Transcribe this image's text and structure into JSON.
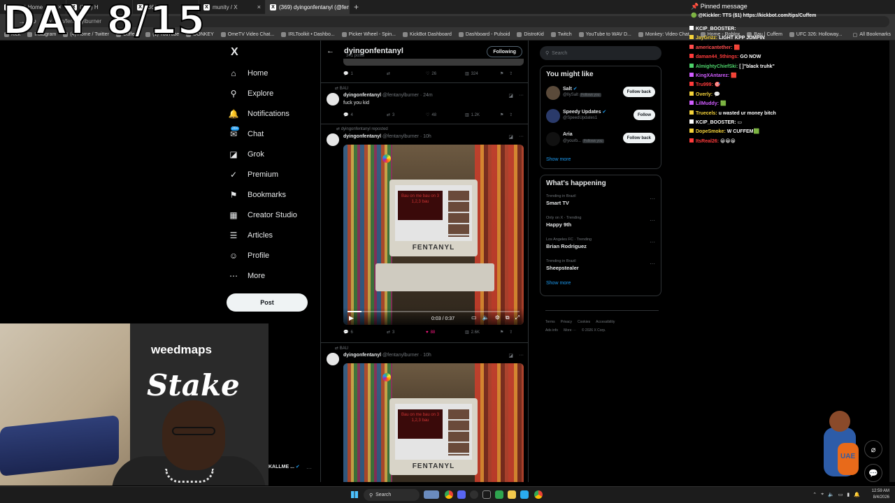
{
  "overlay": {
    "day_title": "DAY 8/15"
  },
  "browser": {
    "tabs": [
      {
        "label": "(369) Home",
        "active": false
      },
      {
        "label": "(369) H",
        "active": false
      },
      {
        "label": "(369)",
        "active": false
      },
      {
        "label": "munity / X",
        "active": false
      },
      {
        "label": "(369) dyingonfentanyl (@fenta",
        "active": true
      }
    ],
    "new_tab": "+",
    "url": "x.com/fentanylburner",
    "bookmarks": [
      "Kick",
      "Instagram",
      "(4) Home / Twitter",
      "Cuffem",
      "(1) YouTube",
      "DONKEY",
      "OmeTV Video Chat...",
      "IRLToolkit • Dashbo...",
      "Picker Wheel - Spin...",
      "KickBot Dashboard",
      "Dashboard - Pulsoid",
      "DistroKid",
      "Twitch",
      "YouTube to WAV D...",
      "Monkey: Video Chat...",
      "Home - Roblox",
      "Bau | Cuffem",
      "UFC 326: Holloway..."
    ],
    "all_bookmarks": "All Bookmarks"
  },
  "x_nav": {
    "logo": "X",
    "items": [
      {
        "label": "Home",
        "icon": "⌂",
        "name": "home"
      },
      {
        "label": "Explore",
        "icon": "⚲",
        "name": "explore"
      },
      {
        "label": "Notifications",
        "icon": "🔔",
        "name": "notifications"
      },
      {
        "label": "Chat",
        "icon": "✉",
        "name": "chat"
      },
      {
        "label": "Grok",
        "icon": "◪",
        "name": "grok"
      },
      {
        "label": "Premium",
        "icon": "✓",
        "name": "premium"
      },
      {
        "label": "Bookmarks",
        "icon": "⚑",
        "name": "bookmarks"
      },
      {
        "label": "Creator Studio",
        "icon": "▦",
        "name": "creator-studio"
      },
      {
        "label": "Articles",
        "icon": "☰",
        "name": "articles"
      },
      {
        "label": "Profile",
        "icon": "☺",
        "name": "profile"
      },
      {
        "label": "More",
        "icon": "⋯",
        "name": "more"
      }
    ],
    "chat_badge": "20+",
    "post_button": "Post"
  },
  "timeline": {
    "back": "←",
    "profile_name": "dyingonfentanyl",
    "post_count": "341 posts",
    "following_button": "Following",
    "top_actions": {
      "replies": "1",
      "reposts": "",
      "likes": "26",
      "views": "324"
    },
    "tweets": [
      {
        "context": "BAU",
        "name": "dyingonfentanyl",
        "handle": "@fentanylburner · 24m",
        "text": "fuck you kid",
        "replies": "4",
        "reposts": "3",
        "likes": "48",
        "views": "1.2K"
      },
      {
        "context": "dyingonfentanyl reposted",
        "name": "dyingonfentanyl",
        "handle": "@fentanylburner · 10h",
        "media_label": "FENTANYL",
        "screen_text": "Bau on me bau on 3 1,2,3 bau",
        "video_time": "0:03 / 0:37",
        "video_progress": 0.08,
        "replies": "6",
        "reposts": "3",
        "likes": "88",
        "views": "2.6K"
      },
      {
        "context": "BAU",
        "name": "dyingonfentanyl",
        "handle": "@fentanylburner · 10h",
        "media_label": "FENTANYL",
        "screen_text": "Bau on me bau on 3 1,2,3 bau"
      }
    ]
  },
  "sidebar": {
    "search_placeholder": "Search",
    "might_like_title": "You might like",
    "suggestions": [
      {
        "name": "Salt",
        "handle": "@llySalt",
        "follows_you": "Follows you",
        "button": "Follow back"
      },
      {
        "name": "Speedy Updates",
        "handle": "@SpeedUpdates1",
        "follows_you": "",
        "button": "Follow"
      },
      {
        "name": "Aria",
        "handle": "@yourb...",
        "follows_you": "Follows you",
        "button": "Follow back"
      }
    ],
    "show_more": "Show more",
    "happening_title": "What's happening",
    "trends": [
      {
        "context": "Trending in Brazil",
        "name": "Smart TV"
      },
      {
        "context": "Only on X · Trending",
        "name": "Happy 9th"
      },
      {
        "context": "Los Angeles FC · Trending",
        "name": "Brian Rodriguez"
      },
      {
        "context": "Trending in Brazil",
        "name": "Sheepstealer"
      }
    ],
    "show_more_2": "Show more",
    "footer": [
      "Terms",
      "Privacy",
      "Cookies",
      "Accessibility",
      "Ads info",
      "More ···",
      "© 2026 X Corp."
    ]
  },
  "chat": {
    "pinned_title": "Pinned message",
    "pinned_text": "@Kickler: TTS ($1) https://kickbot.com/tips/Cuffem",
    "messages": [
      {
        "user": "KCIP_BOOSTER:",
        "text": "",
        "color": "#ffffff"
      },
      {
        "user": "JayGrizz:",
        "text": "LIGHT KPP JUMPIN",
        "color": "#f5d33a"
      },
      {
        "user": "americantether:",
        "text": "🟥",
        "color": "#ff4d4d"
      },
      {
        "user": "daman44_5things:",
        "text": "GO NOW",
        "color": "#ff3b3b"
      },
      {
        "user": "AlmightyChiefSki:",
        "text": "[ ]\"black truhk\"",
        "color": "#4dd36a"
      },
      {
        "user": "KingXAntarez:",
        "text": "🟥",
        "color": "#d05cff"
      },
      {
        "user": "Tru999:",
        "text": "🎯",
        "color": "#ff3b3b"
      },
      {
        "user": "Overly:",
        "text": "💬",
        "color": "#f5d33a"
      },
      {
        "user": "LilMuddy:",
        "text": "🟩",
        "color": "#d05cff"
      },
      {
        "user": "Truecels:",
        "text": "u wasted ur money bitch",
        "color": "#f5d33a"
      },
      {
        "user": "KCIP_BOOSTER:",
        "text": "▭",
        "color": "#ffffff"
      },
      {
        "user": "DopeSmoke:",
        "text": "W CUFFEM🟩",
        "color": "#f5d33a"
      },
      {
        "user": "ItsReal26:",
        "text": "😀😀😀",
        "color": "#ff3b3b"
      }
    ]
  },
  "webcam": {
    "banner_brand": "weedmaps",
    "banner_sponsor": "Stake",
    "account_label": "KALLME ..."
  },
  "mascot": {
    "text": "UAE"
  },
  "taskbar": {
    "search": "Search",
    "time": "12:59 AM",
    "date": "8/4/2026"
  }
}
